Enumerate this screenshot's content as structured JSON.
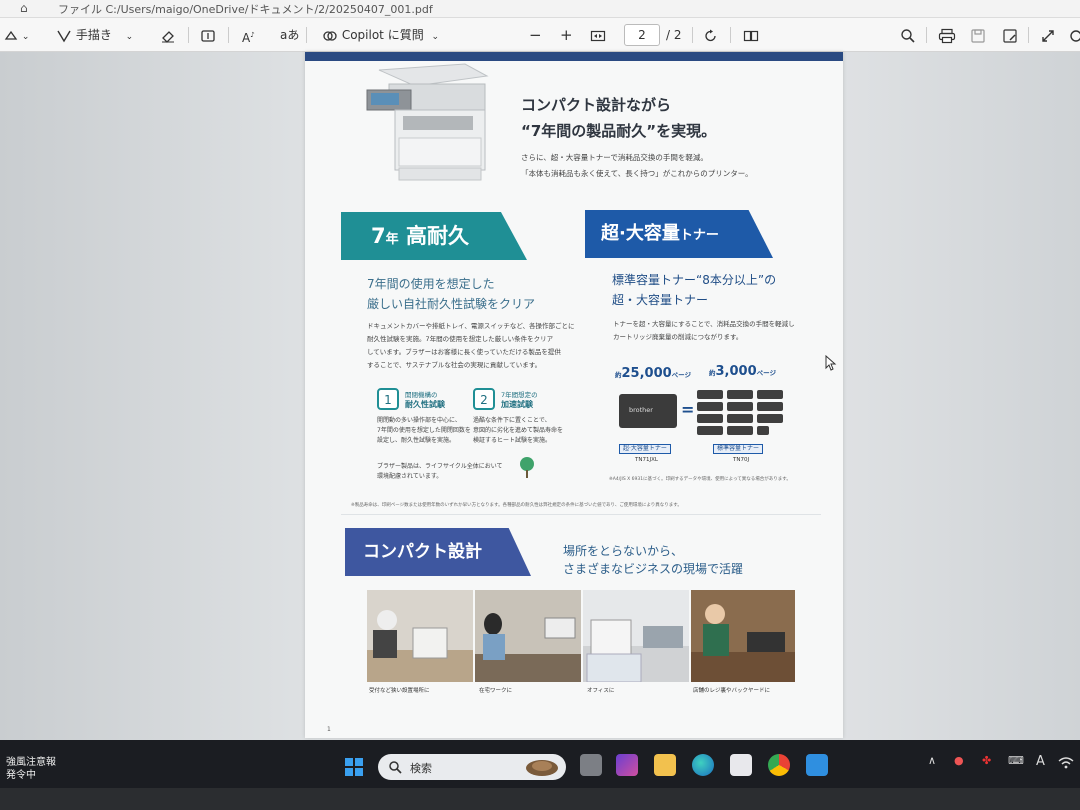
{
  "address_bar": {
    "path": "ファイル  C:/Users/maigo/OneDrive/ドキュメント/2/20250407_001.pdf"
  },
  "toolbar": {
    "handwriting_label": "手描き",
    "text_aa_label": "A",
    "kana_label": "aあ",
    "copilot_label": "Copilot に質問",
    "zoom_out": "−",
    "zoom_in": "+",
    "page_current": "2",
    "page_total": "/ 2"
  },
  "document": {
    "hero_title_1": "コンパクト設計ながら",
    "hero_title_2": "“7年間の製品耐久”を実現。",
    "hero_sub_1": "さらに、超・大容量トナーで消耗品交換の手間を軽減。",
    "hero_sub_2": "「本体も消耗品も永く使えて、長く持つ」がこれからのプリンター。",
    "left": {
      "banner_num": "7",
      "banner_small": "年",
      "banner_text": " 高耐久",
      "heading_1": "7年間の使用を想定した",
      "heading_2": "厳しい自社耐久性試験をクリア",
      "body_1": "ドキュメントカバーや排紙トレイ、電源スイッチなど、各操作部ごとに",
      "body_2": "耐久性試験を実施。7年間の使用を想定した厳しい条件をクリア",
      "body_3": "しています。ブラザーはお客様に長く使っていただける製品を提供",
      "body_4": "することで、サステナブルな社会の実現に貢献しています。",
      "feat1_small": "開閉機構の",
      "feat1_title": "耐久性試験",
      "feat1_body_1": "開閉動の多い操作部を中心に、",
      "feat1_body_2": "7年間の使用を想定した開閉回数を",
      "feat1_body_3": "設定し、耐久性試験を実施。",
      "feat2_small": "7年間想定の",
      "feat2_title": "加速試験",
      "feat2_body_1": "過酷な条件下に置くことで、",
      "feat2_body_2": "意図的に劣化を進めて製品寿命を",
      "feat2_body_3": "検証するヒート試験を実施。",
      "eco_1": "ブラザー製品は、ライフサイクル全体において",
      "eco_2": "環境配慮されています。"
    },
    "right": {
      "banner_text": "超·大容量",
      "banner_small": "トナー",
      "heading_1": "標準容量トナー“8本分以上”の",
      "heading_2": "超・大容量トナー",
      "body_1": "トナーを超・大容量にすることで、消耗品交換の手間を軽減し",
      "body_2": "カートリッジ廃棄量の削減につながります。",
      "num1_prefix": "約",
      "num1": "25,000",
      "num1_unit": "ページ",
      "num2_prefix": "約",
      "num2": "3,000",
      "num2_unit": "ページ",
      "toner_brand": "brother",
      "label_big": "超·大容量トナー",
      "model_big": "TN71JXL",
      "label_std": "標準容量トナー",
      "model_std": "TN70J",
      "footnote": "※A4/JIS X 6931に基づく。印刷するデータや環境、使用によって異なる場合があります。"
    },
    "fine_print": "※製品寿命は、印刷ページ数または使用年数のいずれか早い方となります。各種部品の耐久性は弊社規定の条件に基づいた値であり、ご使用環境により異なります。",
    "compact": {
      "banner_text": "コンパクト設計",
      "copy_1": "場所をとらないから、",
      "copy_2": "さまざまなビジネスの現場で活躍",
      "cap1": "受付など狭い設置場所に",
      "cap2": "在宅ワークに",
      "cap3": "オフィスに",
      "cap4": "店舗のレジ裏やバックヤードに"
    },
    "page_number": "1"
  },
  "taskbar": {
    "weather_1": "強風注意報",
    "weather_2": "発令中",
    "search_label": "検索",
    "lang_label": "A"
  },
  "colors": {
    "teal": "#1f8f95",
    "blue": "#1e5aa8",
    "navy": "#3e57a0",
    "heading_blue": "#1f4d86"
  }
}
